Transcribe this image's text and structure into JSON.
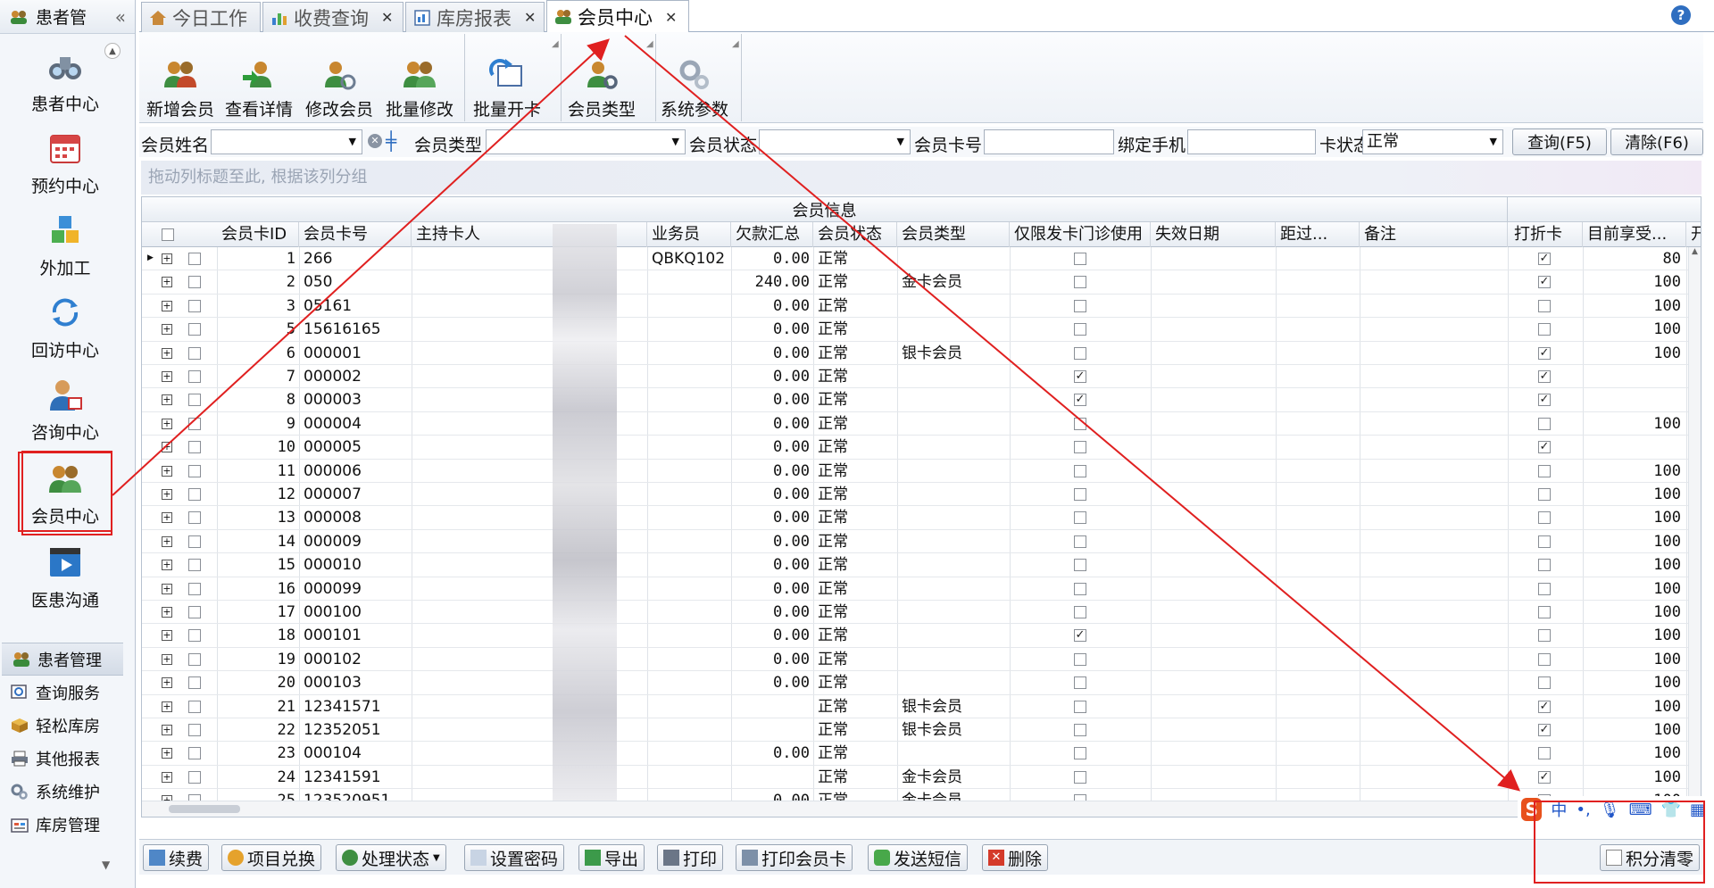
{
  "sidebar": {
    "title": "患者管",
    "nav": [
      {
        "label": "患者中心",
        "icon": "binoculars-icon"
      },
      {
        "label": "预约中心",
        "icon": "calendar-icon"
      },
      {
        "label": "外加工",
        "icon": "cubes-icon"
      },
      {
        "label": "回访中心",
        "icon": "refresh-icon"
      },
      {
        "label": "咨询中心",
        "icon": "consultant-icon"
      },
      {
        "label": "会员中心",
        "icon": "members-icon"
      },
      {
        "label": "医患沟通",
        "icon": "video-icon"
      }
    ],
    "groups": [
      {
        "label": "患者管理",
        "icon": "people-icon"
      },
      {
        "label": "查询服务",
        "icon": "search-icon"
      },
      {
        "label": "轻松库房",
        "icon": "box-icon"
      },
      {
        "label": "其他报表",
        "icon": "printer-icon"
      },
      {
        "label": "系统维护",
        "icon": "gears-icon"
      },
      {
        "label": "库房管理",
        "icon": "warehouse-icon"
      }
    ]
  },
  "tabs": [
    {
      "label": "今日工作",
      "icon": "house-icon"
    },
    {
      "label": "收费查询",
      "icon": "chart-icon"
    },
    {
      "label": "库房报表",
      "icon": "report-icon"
    },
    {
      "label": "会员中心",
      "icon": "members-icon"
    }
  ],
  "ribbon": [
    {
      "label": "新增会员",
      "icon": "add-member-icon"
    },
    {
      "label": "查看详情",
      "icon": "member-arrow-icon"
    },
    {
      "label": "修改会员",
      "icon": "edit-member-icon"
    },
    {
      "label": "批量修改",
      "icon": "batch-member-icon"
    },
    {
      "label": "批量开卡",
      "icon": "card-refresh-icon"
    },
    {
      "label": "会员类型",
      "icon": "member-gear-icon"
    },
    {
      "label": "系统参数",
      "icon": "gears-icon"
    }
  ],
  "filter": {
    "name_label": "会员姓名",
    "type_label": "会员类型",
    "status_label": "会员状态",
    "cardno_label": "会员卡号",
    "phone_label": "绑定手机",
    "cardstatus_label": "卡状态",
    "cardstatus_value": "正常",
    "query_btn": "查询(F5)",
    "clear_btn": "清除(F6)"
  },
  "group_panel_hint": "拖动列标题至此, 根据该列分组",
  "grid": {
    "band_member": "会员信息",
    "columns": [
      "会员卡ID",
      "会员卡号",
      "主持卡人",
      "业务员",
      "欠款汇总",
      "会员状态",
      "会员类型",
      "仅限发卡门诊使用",
      "失效日期",
      "距过...",
      "备注",
      "打折卡",
      "目前享受...",
      "开"
    ],
    "rows": [
      {
        "id": "1",
        "card": "266",
        "agent": "QBKQ102",
        "debt": "0.00",
        "status": "正常",
        "type": "",
        "local": false,
        "disc": true,
        "pct": "80"
      },
      {
        "id": "2",
        "card": "050",
        "agent": "",
        "debt": "240.00",
        "status": "正常",
        "type": "金卡会员",
        "local": false,
        "disc": true,
        "pct": "100"
      },
      {
        "id": "3",
        "card": "05161",
        "agent": "",
        "debt": "0.00",
        "status": "正常",
        "type": "",
        "local": false,
        "disc": false,
        "pct": "100"
      },
      {
        "id": "5",
        "card": "15616165",
        "agent": "",
        "debt": "0.00",
        "status": "正常",
        "type": "",
        "local": false,
        "disc": false,
        "pct": "100"
      },
      {
        "id": "6",
        "card": "000001",
        "agent": "",
        "debt": "0.00",
        "status": "正常",
        "type": "银卡会员",
        "local": false,
        "disc": true,
        "pct": "100"
      },
      {
        "id": "7",
        "card": "000002",
        "agent": "",
        "debt": "0.00",
        "status": "正常",
        "type": "",
        "local": true,
        "disc": true,
        "pct": ""
      },
      {
        "id": "8",
        "card": "000003",
        "agent": "",
        "debt": "0.00",
        "status": "正常",
        "type": "",
        "local": true,
        "disc": true,
        "pct": ""
      },
      {
        "id": "9",
        "card": "000004",
        "agent": "",
        "debt": "0.00",
        "status": "正常",
        "type": "",
        "local": false,
        "disc": false,
        "pct": "100"
      },
      {
        "id": "10",
        "card": "000005",
        "agent": "",
        "debt": "0.00",
        "status": "正常",
        "type": "",
        "local": false,
        "disc": true,
        "pct": ""
      },
      {
        "id": "11",
        "card": "000006",
        "agent": "",
        "debt": "0.00",
        "status": "正常",
        "type": "",
        "local": false,
        "disc": false,
        "pct": "100"
      },
      {
        "id": "12",
        "card": "000007",
        "agent": "",
        "debt": "0.00",
        "status": "正常",
        "type": "",
        "local": false,
        "disc": false,
        "pct": "100"
      },
      {
        "id": "13",
        "card": "000008",
        "agent": "",
        "debt": "0.00",
        "status": "正常",
        "type": "",
        "local": false,
        "disc": false,
        "pct": "100"
      },
      {
        "id": "14",
        "card": "000009",
        "agent": "",
        "debt": "0.00",
        "status": "正常",
        "type": "",
        "local": false,
        "disc": false,
        "pct": "100"
      },
      {
        "id": "15",
        "card": "000010",
        "agent": "",
        "debt": "0.00",
        "status": "正常",
        "type": "",
        "local": false,
        "disc": false,
        "pct": "100"
      },
      {
        "id": "16",
        "card": "000099",
        "agent": "",
        "debt": "0.00",
        "status": "正常",
        "type": "",
        "local": false,
        "disc": false,
        "pct": "100"
      },
      {
        "id": "17",
        "card": "000100",
        "agent": "",
        "debt": "0.00",
        "status": "正常",
        "type": "",
        "local": false,
        "disc": false,
        "pct": "100"
      },
      {
        "id": "18",
        "card": "000101",
        "agent": "",
        "debt": "0.00",
        "status": "正常",
        "type": "",
        "local": true,
        "disc": false,
        "pct": "100"
      },
      {
        "id": "19",
        "card": "000102",
        "agent": "",
        "debt": "0.00",
        "status": "正常",
        "type": "",
        "local": false,
        "disc": false,
        "pct": "100"
      },
      {
        "id": "20",
        "card": "000103",
        "agent": "",
        "debt": "0.00",
        "status": "正常",
        "type": "",
        "local": false,
        "disc": false,
        "pct": "100"
      },
      {
        "id": "21",
        "card": "12341571",
        "agent": "",
        "debt": "",
        "status": "正常",
        "type": "银卡会员",
        "local": false,
        "disc": true,
        "pct": "100"
      },
      {
        "id": "22",
        "card": "12352051",
        "agent": "",
        "debt": "",
        "status": "正常",
        "type": "银卡会员",
        "local": false,
        "disc": true,
        "pct": "100"
      },
      {
        "id": "23",
        "card": "000104",
        "agent": "",
        "debt": "0.00",
        "status": "正常",
        "type": "",
        "local": false,
        "disc": false,
        "pct": "100"
      },
      {
        "id": "24",
        "card": "12341591",
        "agent": "",
        "debt": "",
        "status": "正常",
        "type": "金卡会员",
        "local": false,
        "disc": true,
        "pct": "100"
      },
      {
        "id": "25",
        "card": "123520951",
        "agent": "",
        "debt": "0.00",
        "status": "正常",
        "type": "金卡会员",
        "local": false,
        "disc": false,
        "pct": "100"
      }
    ]
  },
  "bottom": [
    {
      "label": "续费",
      "icon": "renew-icon"
    },
    {
      "label": "项目兑换",
      "icon": "exchange-icon"
    },
    {
      "label": "处理状态",
      "icon": "status-icon"
    },
    {
      "label": "设置密码",
      "icon": "password-icon"
    },
    {
      "label": "导出",
      "icon": "export-icon"
    },
    {
      "label": "打印",
      "icon": "print-icon"
    },
    {
      "label": "打印会员卡",
      "icon": "print-card-icon"
    },
    {
      "label": "发送短信",
      "icon": "sms-icon"
    },
    {
      "label": "删除",
      "icon": "delete-icon"
    }
  ],
  "points_clear": "积分清零",
  "ime": {
    "logo": "S",
    "mode": "中"
  },
  "colors": {
    "annotation": "#e02020",
    "accent": "#2f6ec0"
  }
}
